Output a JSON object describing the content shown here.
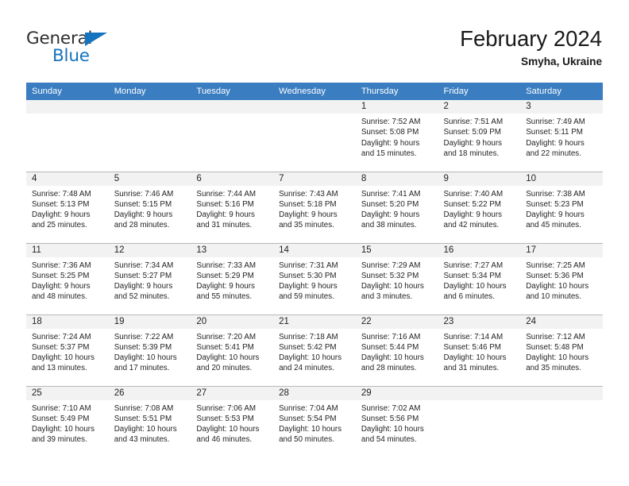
{
  "logo": {
    "line1": "General",
    "line2": "Blue",
    "triangle_color": "#1673bd",
    "text_color": "#2e2e2e"
  },
  "header": {
    "title": "February 2024",
    "subtitle": "Smyha, Ukraine"
  },
  "theme": {
    "header_blue": "#3a7dc1",
    "daynum_band": "#f2f2f2",
    "row_divider": "#b8b8b8",
    "text": "#231f20"
  },
  "calendar": {
    "weekday_headers": [
      "Sunday",
      "Monday",
      "Tuesday",
      "Wednesday",
      "Thursday",
      "Friday",
      "Saturday"
    ],
    "weeks": [
      [
        {
          "day": "",
          "lines": []
        },
        {
          "day": "",
          "lines": []
        },
        {
          "day": "",
          "lines": []
        },
        {
          "day": "",
          "lines": []
        },
        {
          "day": "1",
          "lines": [
            "Sunrise: 7:52 AM",
            "Sunset: 5:08 PM",
            "Daylight: 9 hours",
            "and 15 minutes."
          ]
        },
        {
          "day": "2",
          "lines": [
            "Sunrise: 7:51 AM",
            "Sunset: 5:09 PM",
            "Daylight: 9 hours",
            "and 18 minutes."
          ]
        },
        {
          "day": "3",
          "lines": [
            "Sunrise: 7:49 AM",
            "Sunset: 5:11 PM",
            "Daylight: 9 hours",
            "and 22 minutes."
          ]
        }
      ],
      [
        {
          "day": "4",
          "lines": [
            "Sunrise: 7:48 AM",
            "Sunset: 5:13 PM",
            "Daylight: 9 hours",
            "and 25 minutes."
          ]
        },
        {
          "day": "5",
          "lines": [
            "Sunrise: 7:46 AM",
            "Sunset: 5:15 PM",
            "Daylight: 9 hours",
            "and 28 minutes."
          ]
        },
        {
          "day": "6",
          "lines": [
            "Sunrise: 7:44 AM",
            "Sunset: 5:16 PM",
            "Daylight: 9 hours",
            "and 31 minutes."
          ]
        },
        {
          "day": "7",
          "lines": [
            "Sunrise: 7:43 AM",
            "Sunset: 5:18 PM",
            "Daylight: 9 hours",
            "and 35 minutes."
          ]
        },
        {
          "day": "8",
          "lines": [
            "Sunrise: 7:41 AM",
            "Sunset: 5:20 PM",
            "Daylight: 9 hours",
            "and 38 minutes."
          ]
        },
        {
          "day": "9",
          "lines": [
            "Sunrise: 7:40 AM",
            "Sunset: 5:22 PM",
            "Daylight: 9 hours",
            "and 42 minutes."
          ]
        },
        {
          "day": "10",
          "lines": [
            "Sunrise: 7:38 AM",
            "Sunset: 5:23 PM",
            "Daylight: 9 hours",
            "and 45 minutes."
          ]
        }
      ],
      [
        {
          "day": "11",
          "lines": [
            "Sunrise: 7:36 AM",
            "Sunset: 5:25 PM",
            "Daylight: 9 hours",
            "and 48 minutes."
          ]
        },
        {
          "day": "12",
          "lines": [
            "Sunrise: 7:34 AM",
            "Sunset: 5:27 PM",
            "Daylight: 9 hours",
            "and 52 minutes."
          ]
        },
        {
          "day": "13",
          "lines": [
            "Sunrise: 7:33 AM",
            "Sunset: 5:29 PM",
            "Daylight: 9 hours",
            "and 55 minutes."
          ]
        },
        {
          "day": "14",
          "lines": [
            "Sunrise: 7:31 AM",
            "Sunset: 5:30 PM",
            "Daylight: 9 hours",
            "and 59 minutes."
          ]
        },
        {
          "day": "15",
          "lines": [
            "Sunrise: 7:29 AM",
            "Sunset: 5:32 PM",
            "Daylight: 10 hours",
            "and 3 minutes."
          ]
        },
        {
          "day": "16",
          "lines": [
            "Sunrise: 7:27 AM",
            "Sunset: 5:34 PM",
            "Daylight: 10 hours",
            "and 6 minutes."
          ]
        },
        {
          "day": "17",
          "lines": [
            "Sunrise: 7:25 AM",
            "Sunset: 5:36 PM",
            "Daylight: 10 hours",
            "and 10 minutes."
          ]
        }
      ],
      [
        {
          "day": "18",
          "lines": [
            "Sunrise: 7:24 AM",
            "Sunset: 5:37 PM",
            "Daylight: 10 hours",
            "and 13 minutes."
          ]
        },
        {
          "day": "19",
          "lines": [
            "Sunrise: 7:22 AM",
            "Sunset: 5:39 PM",
            "Daylight: 10 hours",
            "and 17 minutes."
          ]
        },
        {
          "day": "20",
          "lines": [
            "Sunrise: 7:20 AM",
            "Sunset: 5:41 PM",
            "Daylight: 10 hours",
            "and 20 minutes."
          ]
        },
        {
          "day": "21",
          "lines": [
            "Sunrise: 7:18 AM",
            "Sunset: 5:42 PM",
            "Daylight: 10 hours",
            "and 24 minutes."
          ]
        },
        {
          "day": "22",
          "lines": [
            "Sunrise: 7:16 AM",
            "Sunset: 5:44 PM",
            "Daylight: 10 hours",
            "and 28 minutes."
          ]
        },
        {
          "day": "23",
          "lines": [
            "Sunrise: 7:14 AM",
            "Sunset: 5:46 PM",
            "Daylight: 10 hours",
            "and 31 minutes."
          ]
        },
        {
          "day": "24",
          "lines": [
            "Sunrise: 7:12 AM",
            "Sunset: 5:48 PM",
            "Daylight: 10 hours",
            "and 35 minutes."
          ]
        }
      ],
      [
        {
          "day": "25",
          "lines": [
            "Sunrise: 7:10 AM",
            "Sunset: 5:49 PM",
            "Daylight: 10 hours",
            "and 39 minutes."
          ]
        },
        {
          "day": "26",
          "lines": [
            "Sunrise: 7:08 AM",
            "Sunset: 5:51 PM",
            "Daylight: 10 hours",
            "and 43 minutes."
          ]
        },
        {
          "day": "27",
          "lines": [
            "Sunrise: 7:06 AM",
            "Sunset: 5:53 PM",
            "Daylight: 10 hours",
            "and 46 minutes."
          ]
        },
        {
          "day": "28",
          "lines": [
            "Sunrise: 7:04 AM",
            "Sunset: 5:54 PM",
            "Daylight: 10 hours",
            "and 50 minutes."
          ]
        },
        {
          "day": "29",
          "lines": [
            "Sunrise: 7:02 AM",
            "Sunset: 5:56 PM",
            "Daylight: 10 hours",
            "and 54 minutes."
          ]
        },
        {
          "day": "",
          "lines": []
        },
        {
          "day": "",
          "lines": []
        }
      ]
    ]
  }
}
